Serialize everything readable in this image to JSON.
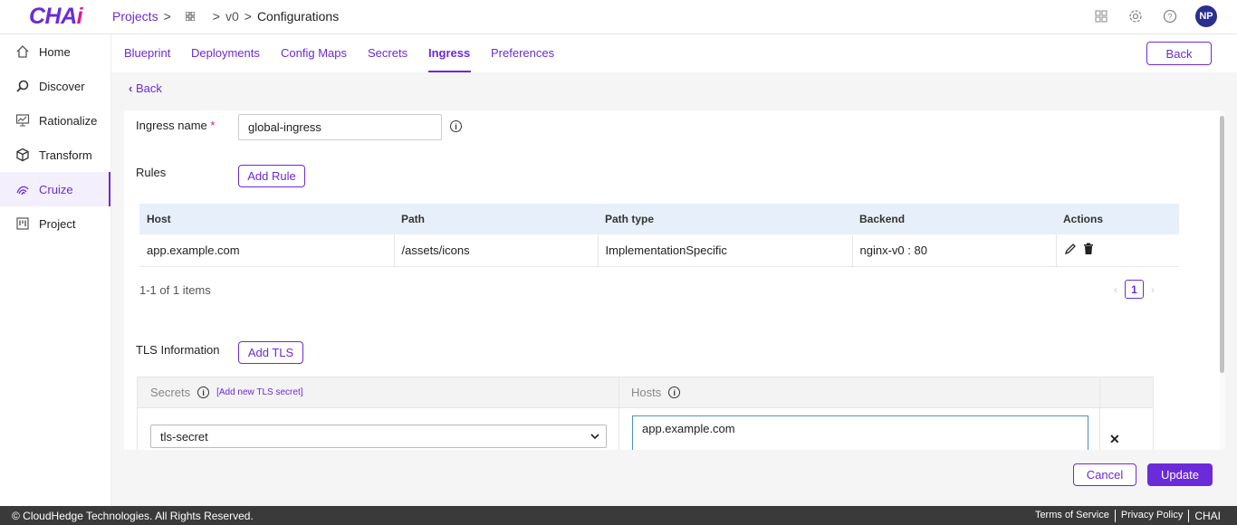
{
  "brand": {
    "logo_main": "CHA",
    "logo_accent": "i"
  },
  "breadcrumb": {
    "projects": "Projects",
    "version": "v0",
    "current": "Configurations"
  },
  "user": {
    "initials": "NP"
  },
  "sidebar": {
    "items": [
      {
        "label": "Home",
        "icon": "home-icon"
      },
      {
        "label": "Discover",
        "icon": "discover-icon"
      },
      {
        "label": "Rationalize",
        "icon": "rationalize-icon"
      },
      {
        "label": "Transform",
        "icon": "transform-icon"
      },
      {
        "label": "Cruize",
        "icon": "cruize-icon",
        "active": true
      },
      {
        "label": "Project",
        "icon": "project-icon"
      }
    ]
  },
  "tabs": [
    {
      "label": "Blueprint"
    },
    {
      "label": "Deployments"
    },
    {
      "label": "Config Maps"
    },
    {
      "label": "Secrets"
    },
    {
      "label": "Ingress",
      "active": true
    },
    {
      "label": "Preferences"
    }
  ],
  "buttons": {
    "back_top": "Back",
    "back_link": "Back",
    "add_rule": "Add Rule",
    "add_tls": "Add TLS",
    "cancel": "Cancel",
    "update": "Update"
  },
  "form": {
    "ingress_label": "Ingress name",
    "required_mark": "*",
    "ingress_value": "global-ingress",
    "rules_label": "Rules",
    "tls_label": "TLS Information"
  },
  "rules_table": {
    "headers": [
      "Host",
      "Path",
      "Path type",
      "Backend",
      "Actions"
    ],
    "rows": [
      {
        "host": "app.example.com",
        "path": "/assets/icons",
        "path_type": "ImplementationSpecific",
        "backend": "nginx-v0 : 80"
      }
    ],
    "summary": "1-1 of 1 items",
    "page": "1"
  },
  "tls_table": {
    "secrets_header": "Secrets",
    "add_secret_link": "[Add new TLS secret]",
    "hosts_header": "Hosts",
    "secret_value": "tls-secret",
    "hosts_value": "app.example.com"
  },
  "footer": {
    "copyright": "© CloudHedge Technologies. All Rights Reserved.",
    "links": [
      "Terms of Service",
      "Privacy Policy",
      "CHAI"
    ]
  },
  "colors": {
    "accent": "#6b2bd9",
    "brand_pink": "#e0168f",
    "table_header": "#e7f0fa",
    "footer_bg": "#3a3a3a"
  }
}
